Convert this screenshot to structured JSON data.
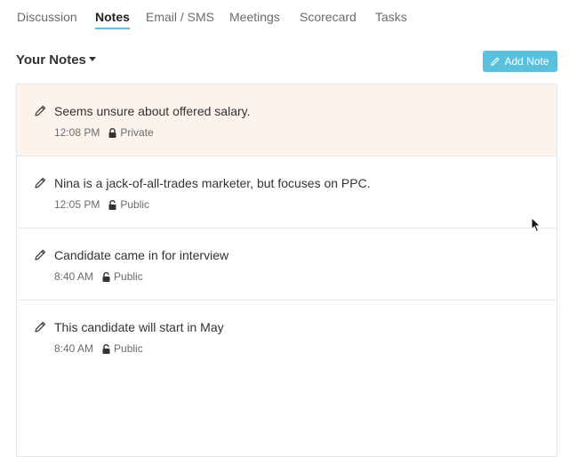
{
  "tabs": [
    {
      "label": "Discussion",
      "active": false
    },
    {
      "label": "Notes",
      "active": true
    },
    {
      "label": "Email / SMS",
      "active": false
    },
    {
      "label": "Meetings",
      "active": false
    },
    {
      "label": "Scorecard",
      "active": false
    },
    {
      "label": "Tasks",
      "active": false
    }
  ],
  "section": {
    "title": "Your Notes"
  },
  "add_note": {
    "label": "Add Note",
    "icon": "pencil-icon"
  },
  "colors": {
    "accent": "#5bc0de",
    "highlight_row": "#fdf3ed"
  },
  "notes": [
    {
      "text": "Seems unsure about offered salary.",
      "time": "12:08 PM",
      "visibility": "Private",
      "highlighted": true
    },
    {
      "text": "Nina is a jack-of-all-trades marketer, but focuses on PPC.",
      "time": "12:05 PM",
      "visibility": "Public",
      "highlighted": false
    },
    {
      "text": "Candidate came in for interview",
      "time": "8:40 AM",
      "visibility": "Public",
      "highlighted": false
    },
    {
      "text": "This candidate will start in May",
      "time": "8:40 AM",
      "visibility": "Public",
      "highlighted": false
    }
  ]
}
